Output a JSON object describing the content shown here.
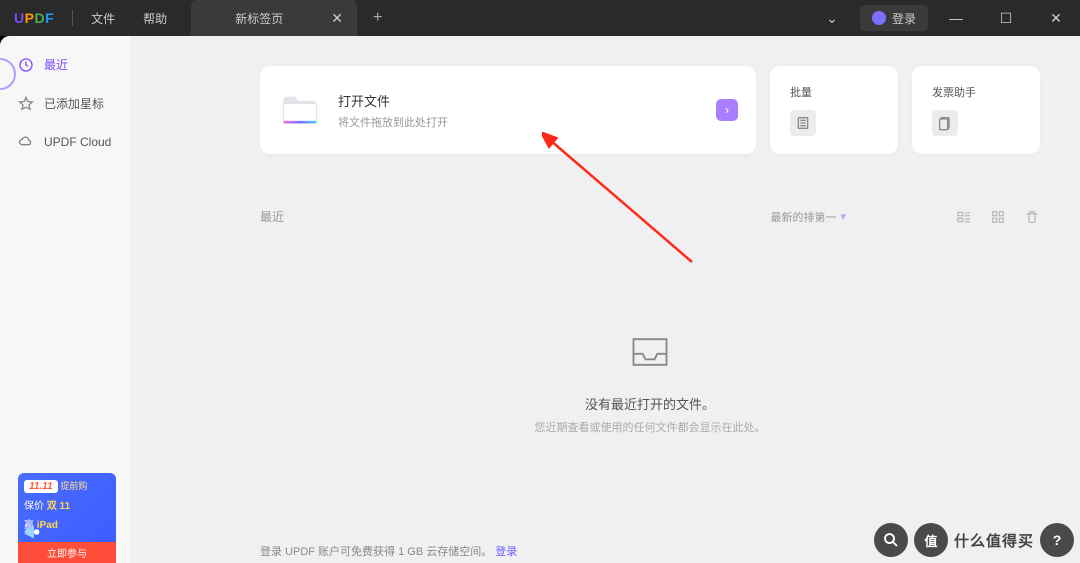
{
  "titlebar": {
    "menu_file": "文件",
    "menu_help": "帮助",
    "tab_title": "新标签页",
    "login": "登录"
  },
  "sidebar": {
    "items": [
      {
        "label": "最近"
      },
      {
        "label": "已添加星标"
      },
      {
        "label": "UPDF Cloud"
      }
    ]
  },
  "cards": {
    "open": {
      "title": "打开文件",
      "subtitle": "将文件拖放到此处打开"
    },
    "batch": {
      "title": "批量"
    },
    "invoice": {
      "title": "发票助手"
    }
  },
  "recent": {
    "label": "最近",
    "sort": "最新的排第一",
    "empty_title": "没有最近打开的文件。",
    "empty_sub": "您近期查看或使用的任何文件都会显示在此处。"
  },
  "footer": {
    "msg": "登录 UPDF 账户可免费获得 1 GB 云存储空间。",
    "link": "登录"
  },
  "promo": {
    "tag": "11.11",
    "tag_sub": "提前购",
    "line2a": "保价",
    "line2b": "双 11",
    "line3a": "赢",
    "line3b": "iPad",
    "cta": "立即参与"
  },
  "watermark": {
    "text": "什么值得买"
  }
}
